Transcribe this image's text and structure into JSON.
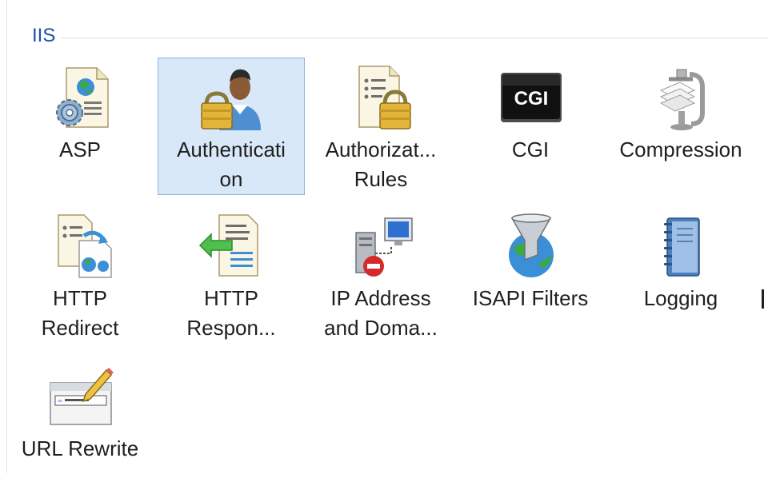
{
  "group": {
    "title": "IIS"
  },
  "features": [
    {
      "label": "ASP",
      "icon": "asp-icon",
      "selected": false
    },
    {
      "label": "Authenticati\non",
      "icon": "authentication-icon",
      "selected": true
    },
    {
      "label": "Authorizat...\nRules",
      "icon": "authorization-rules-icon",
      "selected": false
    },
    {
      "label": "CGI",
      "icon": "cgi-icon",
      "icon_text": "CGI",
      "selected": false
    },
    {
      "label": "Compression",
      "icon": "compression-icon",
      "selected": false
    },
    {
      "label": "HTTP\nRedirect",
      "icon": "http-redirect-icon",
      "selected": false
    },
    {
      "label": "HTTP\nRespon...",
      "icon": "http-response-headers-icon",
      "selected": false
    },
    {
      "label": "IP Address\nand Doma...",
      "icon": "ip-address-domain-icon",
      "selected": false
    },
    {
      "label": "ISAPI Filters",
      "icon": "isapi-filters-icon",
      "selected": false
    },
    {
      "label": "Logging",
      "icon": "logging-icon",
      "selected": false
    },
    {
      "label": "URL Rewrite",
      "icon": "url-rewrite-icon",
      "selected": false
    }
  ],
  "colors": {
    "selection_background": "#d9e8f8",
    "selection_border": "#89b4e2",
    "group_title": "#1e4fa8"
  }
}
